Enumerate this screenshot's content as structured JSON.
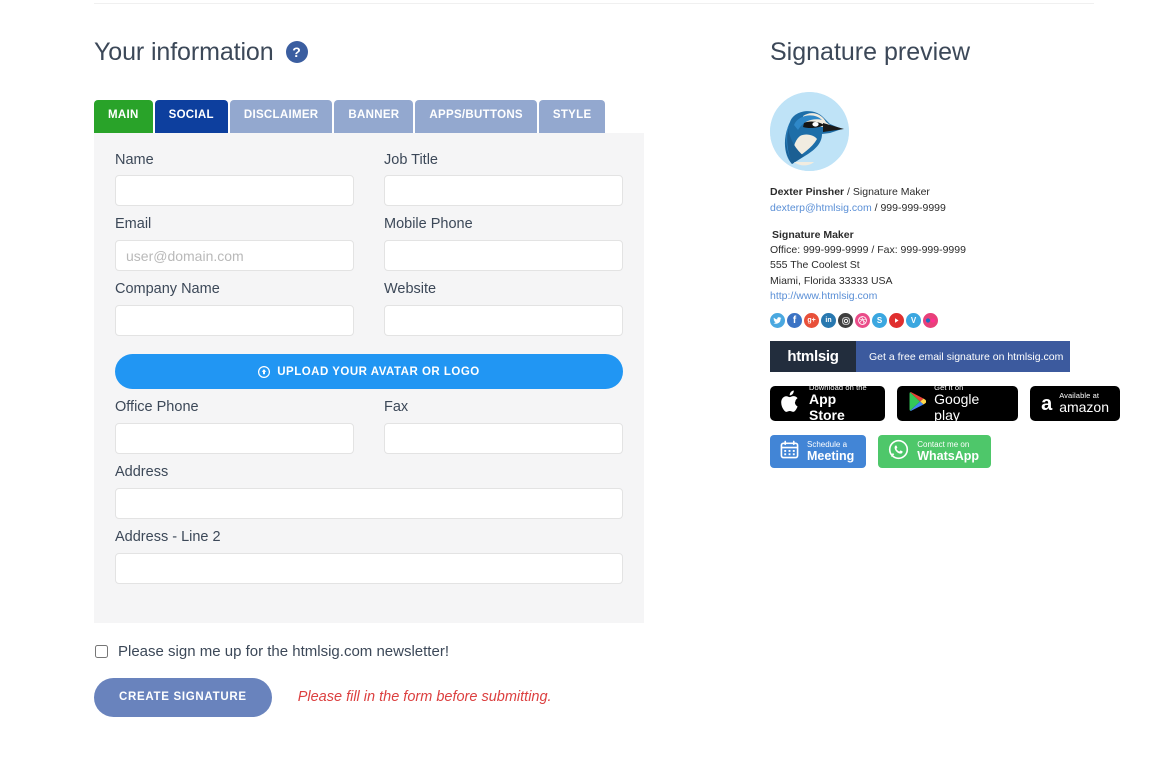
{
  "form_section": {
    "title": "Your information",
    "help_icon": "question-mark-icon",
    "tabs": [
      {
        "label": "MAIN",
        "state": "active-green"
      },
      {
        "label": "SOCIAL",
        "state": "active-blue"
      },
      {
        "label": "DISCLAIMER",
        "state": "inactive"
      },
      {
        "label": "BANNER",
        "state": "inactive"
      },
      {
        "label": "APPS/BUTTONS",
        "state": "inactive"
      },
      {
        "label": "STYLE",
        "state": "inactive"
      }
    ],
    "fields": {
      "name": {
        "label": "Name",
        "value": "",
        "placeholder": ""
      },
      "job_title": {
        "label": "Job Title",
        "value": "",
        "placeholder": ""
      },
      "email": {
        "label": "Email",
        "value": "",
        "placeholder": "user@domain.com"
      },
      "mobile_phone": {
        "label": "Mobile Phone",
        "value": "",
        "placeholder": ""
      },
      "company_name": {
        "label": "Company Name",
        "value": "",
        "placeholder": ""
      },
      "website": {
        "label": "Website",
        "value": "",
        "placeholder": ""
      },
      "office_phone": {
        "label": "Office Phone",
        "value": "",
        "placeholder": ""
      },
      "fax": {
        "label": "Fax",
        "value": "",
        "placeholder": ""
      },
      "address": {
        "label": "Address",
        "value": "",
        "placeholder": ""
      },
      "address_line2": {
        "label": "Address - Line 2",
        "value": "",
        "placeholder": ""
      }
    },
    "upload_button": {
      "label": "UPLOAD YOUR AVATAR OR LOGO",
      "icon": "upload-circle-icon"
    },
    "newsletter": {
      "label": "Please sign me up for the htmlsig.com newsletter!",
      "checked": false
    },
    "submit_button": {
      "label": "CREATE SIGNATURE"
    },
    "error_message": "Please fill in the form before submitting."
  },
  "preview_section": {
    "title": "Signature preview",
    "avatar": {
      "icon": "blue-jay-bird-avatar"
    },
    "person": {
      "name": "Dexter Pinsher",
      "separator": " / ",
      "role": "Signature Maker",
      "email": "dexterp@htmlsig.com",
      "phone_separator": " / ",
      "phone": "999-999-9999"
    },
    "company": {
      "name": "Signature Maker",
      "office_fax": "Office: 999-999-9999 / Fax: 999-999-9999",
      "street": "555 The Coolest St",
      "city_state_zip": "Miami, Florida 33333 USA",
      "website": "http://www.htmlsig.com"
    },
    "social_icons": [
      {
        "name": "twitter-icon",
        "glyph": "ᵥ",
        "color": "#49a9e8"
      },
      {
        "name": "facebook-icon",
        "glyph": "f",
        "color": "#3b73c4"
      },
      {
        "name": "google-plus-icon",
        "glyph": "g+",
        "color": "#e8503a"
      },
      {
        "name": "linkedin-icon",
        "glyph": "in",
        "color": "#2878b0"
      },
      {
        "name": "instagram-icon",
        "glyph": "□",
        "color": "#3f3f3f"
      },
      {
        "name": "dribbble-icon",
        "glyph": "●",
        "color": "#e playing"
      },
      {
        "name": "skype-icon",
        "glyph": "S",
        "color": "#3ba7e0"
      },
      {
        "name": "youtube-icon",
        "glyph": "▶",
        "color": "#e02f2f"
      },
      {
        "name": "vimeo-icon",
        "glyph": "V",
        "color": "#3ba7e0"
      },
      {
        "name": "flickr-icon",
        "glyph": "●●",
        "color": "#e8407a"
      }
    ],
    "banner": {
      "brand": "htmlsig",
      "message": "Get a free email signature on htmlsig.com"
    },
    "store_badges": [
      {
        "name": "app-store-badge",
        "icon": "apple-icon",
        "sub": "Download on the",
        "main": "App Store",
        "main_thin": false
      },
      {
        "name": "google-play-badge",
        "icon": "google-play-icon",
        "sub": "Get it on",
        "main": "Google play",
        "main_thin": true
      },
      {
        "name": "amazon-badge",
        "icon": "amazon-icon",
        "sub": "Available at",
        "main": "amazon",
        "main_thin": true
      }
    ],
    "action_buttons": [
      {
        "name": "schedule-meeting-button",
        "icon": "calendar-icon",
        "sub": "Schedule a",
        "main": "Meeting",
        "color": "#4285d6"
      },
      {
        "name": "whatsapp-button",
        "icon": "whatsapp-icon",
        "sub": "Contact me on",
        "main": "WhatsApp",
        "color": "#4ec76a"
      }
    ]
  },
  "colors": {
    "tab_active_green": "#29a329",
    "tab_active_blue": "#0d3f9e",
    "tab_inactive": "#93a8cf",
    "upload_blue": "#2196f3",
    "submit_purple": "#6983bd",
    "error_red": "#dc4040",
    "panel_bg": "#f5f5f6"
  }
}
